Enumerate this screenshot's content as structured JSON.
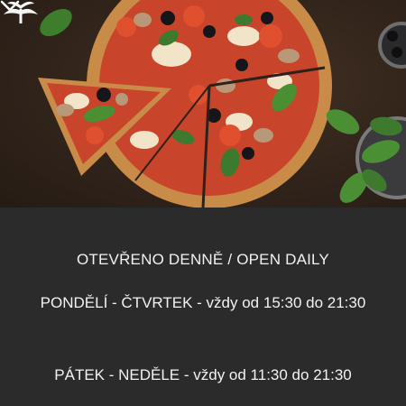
{
  "header": {
    "logo_icon": "tree-logo-icon",
    "scroll_icon": "chevron-down-icon"
  },
  "hero": {
    "image": "pizza-photo"
  },
  "hours": {
    "heading": "OTEVŘENO DENNĚ / OPEN DAILY",
    "rows": [
      {
        "label": "PONDĚLÍ - ČTVRTEK - vždy od 15:30 do 21:30"
      },
      {
        "label": "PÁTEK - NEDĚLE - vždy od 11:30 do 21:30"
      }
    ]
  },
  "colors": {
    "background": "#2b2b2b",
    "text": "#f2f2f2"
  }
}
